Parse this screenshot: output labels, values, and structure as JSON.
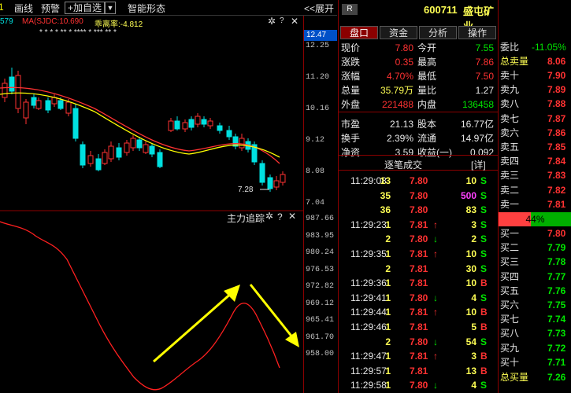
{
  "toolbar": {
    "draw_line": "画线",
    "alert": "预警",
    "add_watch": "+加自选",
    "dropdown": "▼",
    "smart_shape": "智能形态",
    "expand": "<<展开"
  },
  "indicator_line": {
    "left_cut": "579",
    "name": "MA(SJDC:10.690",
    "deviation": "乖离率:-4.812"
  },
  "stars": {
    "pattern": "*  *  *  *  **  *  ****  *  ***  **  *"
  },
  "price_axis": {
    "top_value": "12.47",
    "ticks": [
      "12.25",
      "11.20",
      "10.16",
      "9.12",
      "8.08",
      "7.04"
    ],
    "low_label": "7.28"
  },
  "lower_panel": {
    "title": "主力追踪",
    "ticks": [
      "987.66",
      "983.95",
      "980.24",
      "976.53",
      "972.82",
      "969.12",
      "965.41",
      "961.70",
      "958.00"
    ]
  },
  "quote": {
    "market_badge": "R",
    "code": "600711",
    "name": "盛屯矿业",
    "tabs": [
      "盘口",
      "资金",
      "分析",
      "操作"
    ],
    "rows": [
      {
        "l1": "现价",
        "v1": "7.80",
        "c1": "red",
        "l2": "今开",
        "v2": "7.55",
        "c2": "green"
      },
      {
        "l1": "涨跌",
        "v1": "0.35",
        "c1": "red",
        "l2": "最高",
        "v2": "7.86",
        "c2": "red"
      },
      {
        "l1": "涨幅",
        "v1": "4.70%",
        "c1": "red",
        "l2": "最低",
        "v2": "7.50",
        "c2": "red"
      },
      {
        "l1": "总量",
        "v1": "35.79万",
        "c1": "yellow",
        "l2": "量比",
        "v2": "1.27",
        "c2": "white"
      },
      {
        "l1": "外盘",
        "v1": "221488",
        "c1": "red",
        "l2": "内盘",
        "v2": "136458",
        "c2": "green"
      },
      {
        "l1": "市盈",
        "v1": "21.13",
        "c1": "white",
        "l2": "股本",
        "v2": "16.77亿",
        "c2": "white"
      },
      {
        "l1": "换手",
        "v1": "2.39%",
        "c1": "white",
        "l2": "流通",
        "v2": "14.97亿",
        "c2": "white"
      },
      {
        "l1": "净资",
        "v1": "3.59",
        "c1": "white",
        "l2": "收益(一)",
        "v2": "0.092",
        "c2": "white"
      }
    ],
    "trades_title": "逐笔成交",
    "detail": "[详]",
    "trades": [
      {
        "time": "11:29:08",
        "vol": "13",
        "price": "7.80",
        "arrow": "",
        "qty": "10",
        "side": "S",
        "qc": "yellow"
      },
      {
        "time": "",
        "vol": "35",
        "price": "7.80",
        "arrow": "",
        "qty": "500",
        "side": "S",
        "qc": "magenta"
      },
      {
        "time": "",
        "vol": "36",
        "price": "7.80",
        "arrow": "",
        "qty": "83",
        "side": "S",
        "qc": "yellow"
      },
      {
        "time": "11:29:23",
        "vol": "1",
        "price": "7.81",
        "arrow": "↑",
        "qty": "3",
        "side": "S",
        "qc": "yellow"
      },
      {
        "time": "",
        "vol": "2",
        "price": "7.80",
        "arrow": "↓",
        "qty": "2",
        "side": "S",
        "qc": "yellow"
      },
      {
        "time": "11:29:35",
        "vol": "1",
        "price": "7.81",
        "arrow": "↑",
        "qty": "10",
        "side": "S",
        "qc": "yellow"
      },
      {
        "time": "",
        "vol": "2",
        "price": "7.81",
        "arrow": "",
        "qty": "30",
        "side": "S",
        "qc": "yellow"
      },
      {
        "time": "11:29:36",
        "vol": "1",
        "price": "7.81",
        "arrow": "",
        "qty": "10",
        "side": "B",
        "qc": "yellow"
      },
      {
        "time": "11:29:41",
        "vol": "1",
        "price": "7.80",
        "arrow": "↓",
        "qty": "4",
        "side": "S",
        "qc": "yellow"
      },
      {
        "time": "11:29:44",
        "vol": "1",
        "price": "7.81",
        "arrow": "↑",
        "qty": "10",
        "side": "B",
        "qc": "yellow"
      },
      {
        "time": "11:29:46",
        "vol": "1",
        "price": "7.81",
        "arrow": "",
        "qty": "5",
        "side": "B",
        "qc": "yellow"
      },
      {
        "time": "",
        "vol": "2",
        "price": "7.80",
        "arrow": "↓",
        "qty": "54",
        "side": "S",
        "qc": "yellow"
      },
      {
        "time": "11:29:47",
        "vol": "1",
        "price": "7.81",
        "arrow": "↑",
        "qty": "3",
        "side": "B",
        "qc": "yellow"
      },
      {
        "time": "11:29:57",
        "vol": "1",
        "price": "7.81",
        "arrow": "",
        "qty": "13",
        "side": "B",
        "qc": "yellow"
      },
      {
        "time": "11:29:58",
        "vol": "1",
        "price": "7.80",
        "arrow": "↓",
        "qty": "4",
        "side": "S",
        "qc": "yellow"
      }
    ]
  },
  "order_book": {
    "ratio_label": "委比",
    "ratio_value": "-11.05%",
    "total_sell_label": "总卖量",
    "total_sell_value": "8.06",
    "sells": [
      {
        "label": "卖十",
        "price": "7.90"
      },
      {
        "label": "卖九",
        "price": "7.89"
      },
      {
        "label": "卖八",
        "price": "7.88"
      },
      {
        "label": "卖七",
        "price": "7.87"
      },
      {
        "label": "卖六",
        "price": "7.86"
      },
      {
        "label": "卖五",
        "price": "7.85"
      },
      {
        "label": "卖四",
        "price": "7.84"
      },
      {
        "label": "卖三",
        "price": "7.83"
      },
      {
        "label": "卖二",
        "price": "7.82"
      },
      {
        "label": "卖一",
        "price": "7.81"
      }
    ],
    "buy_ratio": 0.44,
    "buy_ratio_label": "44%",
    "buys": [
      {
        "label": "买一",
        "price": "7.80"
      },
      {
        "label": "买二",
        "price": "7.79"
      },
      {
        "label": "买三",
        "price": "7.78"
      },
      {
        "label": "买四",
        "price": "7.77"
      },
      {
        "label": "买五",
        "price": "7.76"
      },
      {
        "label": "买六",
        "price": "7.75"
      },
      {
        "label": "买七",
        "price": "7.74"
      },
      {
        "label": "买八",
        "price": "7.73"
      },
      {
        "label": "买九",
        "price": "7.72"
      },
      {
        "label": "买十",
        "price": "7.71"
      }
    ],
    "total_buy_label": "总买量",
    "total_buy_value": "7.26"
  },
  "colors": {
    "up": "#ff3232",
    "down": "#00e0e0",
    "ma1": "#ff3232",
    "ma2": "#ffff00",
    "accent_border": "#8b0000",
    "arrow": "#ffff00"
  }
}
